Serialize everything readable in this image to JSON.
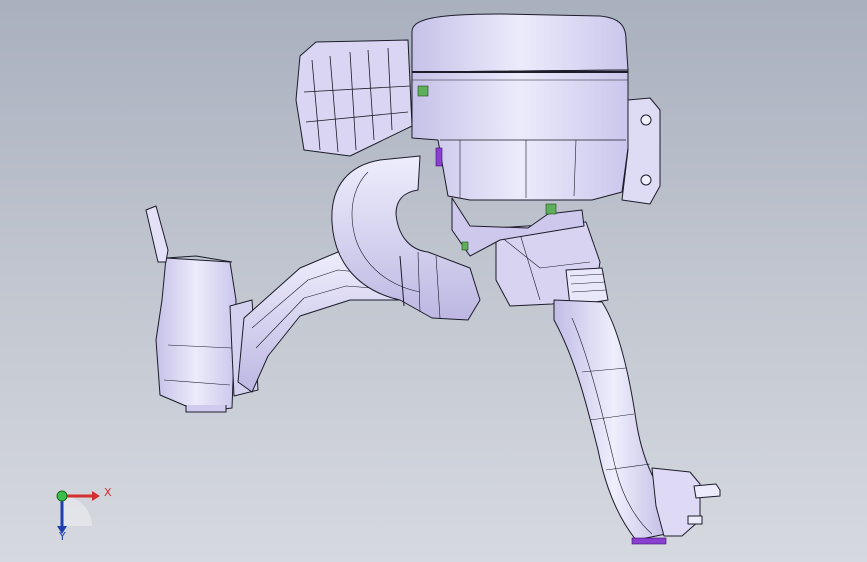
{
  "viewport": {
    "background_top": "#a9b0be",
    "background_bottom": "#d6d9df"
  },
  "model": {
    "fill": "#dcd9f2",
    "shadow": "#b9b4de",
    "edge": "#1c1c2a"
  },
  "triad": {
    "x_label": "X",
    "y_label": "Y",
    "x_color": "#d32f2f",
    "y_color": "#1f3fb0",
    "origin_color": "#3cbf4a"
  }
}
